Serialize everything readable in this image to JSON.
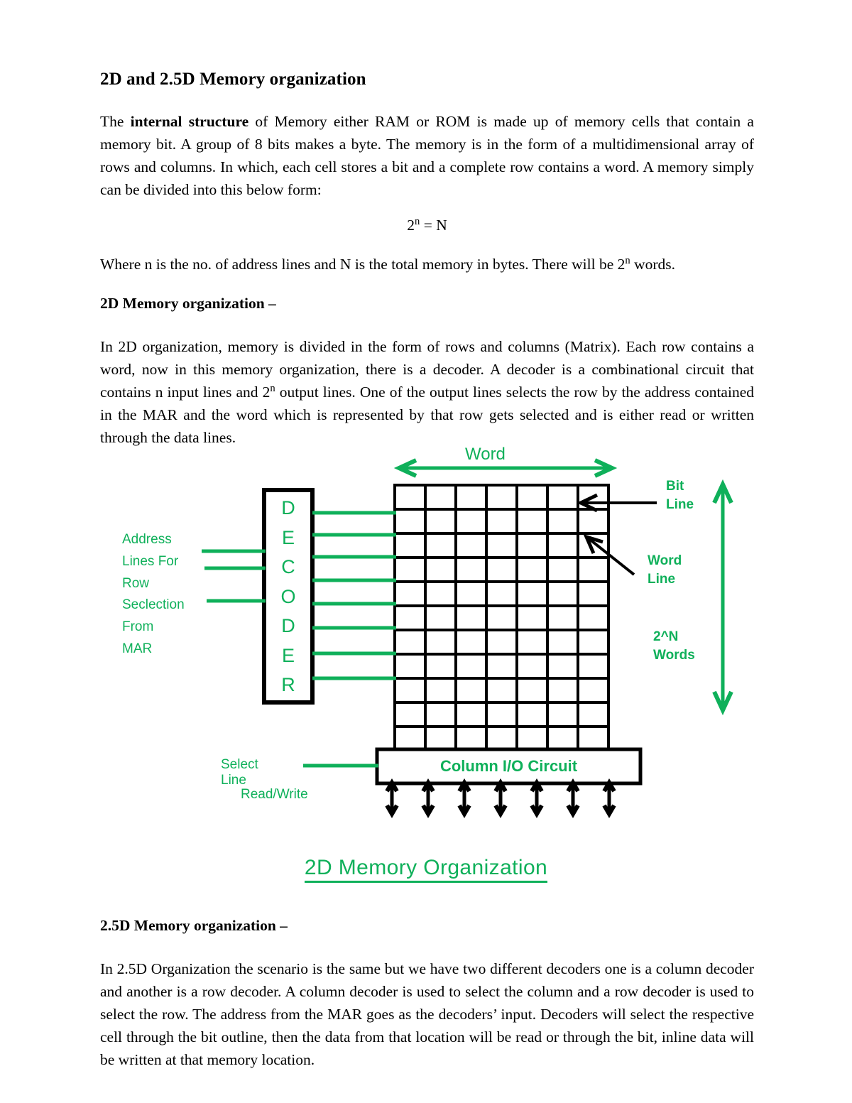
{
  "document": {
    "title": "2D and 2.5D Memory organization",
    "paragraph_1_parts": {
      "a": "The ",
      "bold": "internal structure",
      "b": " of Memory either RAM or ROM is made up of memory cells that contain a memory bit. A group of 8 bits makes a byte. The memory is in the form of a multidimensional array of rows and columns. In which, each cell stores a bit and a complete row contains a word. A memory simply can be divided into this below form:"
    },
    "formula": {
      "base": "2",
      "exponent": "n",
      "rest": " = N"
    },
    "paragraph_2_parts": {
      "a": "Where n is the no. of address lines and N is the total memory in bytes. There will be 2",
      "sup": "n",
      "b": " words."
    },
    "heading_2d": "2D Memory organization –",
    "paragraph_3_parts": {
      "a": "In 2D organization, memory is divided in the form of rows and columns (Matrix). Each row contains a word, now in this memory organization, there is a decoder. A decoder is a combinational circuit that contains n input lines and 2",
      "sup": "n",
      "b": " output lines. One of the output lines selects the row by the address contained in the MAR and the word which is represented by that row gets selected and is either read or written through the data lines."
    },
    "heading_25d": "2.5D Memory organization –",
    "paragraph_4": "In 2.5D Organization the scenario is the same but we have two different decoders one is a column decoder and another is a row decoder. A column decoder is used to select the column and a row decoder is used to select the row. The address from the MAR goes as the decoders’ input. Decoders will select the respective cell through the bit outline, then the data from that location will be read or through the bit, inline data will be written at that memory location."
  },
  "figure": {
    "caption": "2D Memory Organization",
    "labels": {
      "word": "Word",
      "bit_line_1": "Bit",
      "bit_line_2": "Line",
      "word_line_1": "Word",
      "word_line_2": "Line",
      "words_count_1": "2^N",
      "words_count_2": "Words",
      "address_1": "Address",
      "address_2": "Lines For",
      "address_3": "Row",
      "address_4": "Seclection",
      "address_5": "From MAR",
      "select_line": "Select Line",
      "read_write": "Read/Write",
      "column_io": "Column I/O Circuit"
    },
    "decoder_letters": [
      "D",
      "E",
      "C",
      "O",
      "D",
      "E",
      "R"
    ],
    "grid": {
      "columns": 7,
      "rows": 11
    },
    "decoder_output_lines": 8,
    "decoder_input_lines": 3,
    "io_arrows": 7,
    "colors": {
      "green": "#0fb05a",
      "black": "#000000",
      "white": "#ffffff"
    }
  }
}
